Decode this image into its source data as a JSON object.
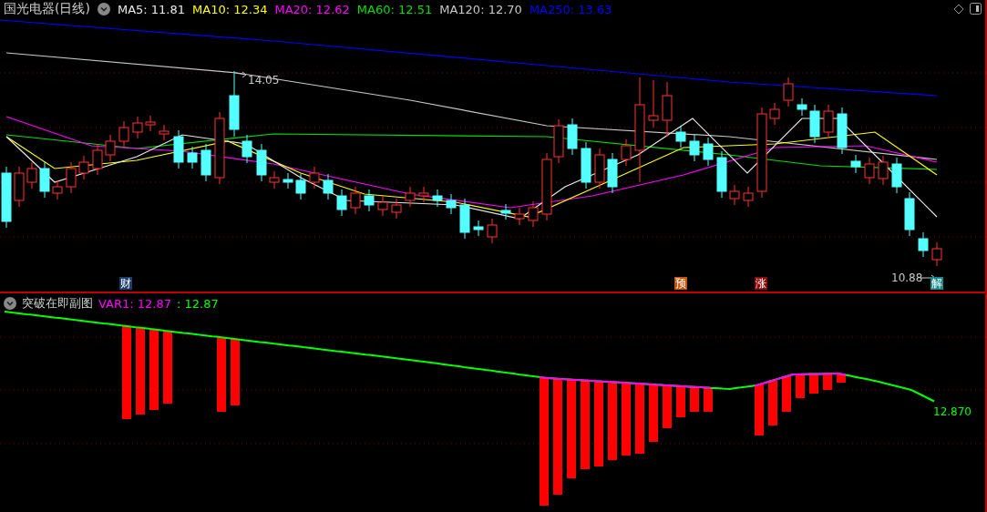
{
  "header": {
    "title": "国光电器(日线)",
    "ma_labels": [
      {
        "label": "MA5: 11.81",
        "color": "#e8e8e8"
      },
      {
        "label": "MA10: 12.34",
        "color": "#ffff00"
      },
      {
        "label": "MA20: 12.62",
        "color": "#ff00ff"
      },
      {
        "label": "MA60: 12.51",
        "color": "#00e000"
      },
      {
        "label": "MA120: 12.70",
        "color": "#c8c8c8"
      },
      {
        "label": "MA250: 13.63",
        "color": "#0000ff"
      }
    ]
  },
  "price_marks": {
    "high": "14.05",
    "low": "10.88"
  },
  "event_badges": [
    {
      "label": "财",
      "color": "#1c3f6e"
    },
    {
      "label": "预",
      "color": "#c0540c"
    },
    {
      "label": "涨",
      "color": "#8a0a0a"
    },
    {
      "label": "解",
      "color": "#148a8a"
    }
  ],
  "indicator": {
    "title": "突破在即副图",
    "values": [
      {
        "label": "VAR1: 12.87",
        "color": "#ff00ff"
      },
      {
        "label": ": 12.87",
        "color": "#00ff00"
      }
    ],
    "last_value": "12.870"
  }
}
